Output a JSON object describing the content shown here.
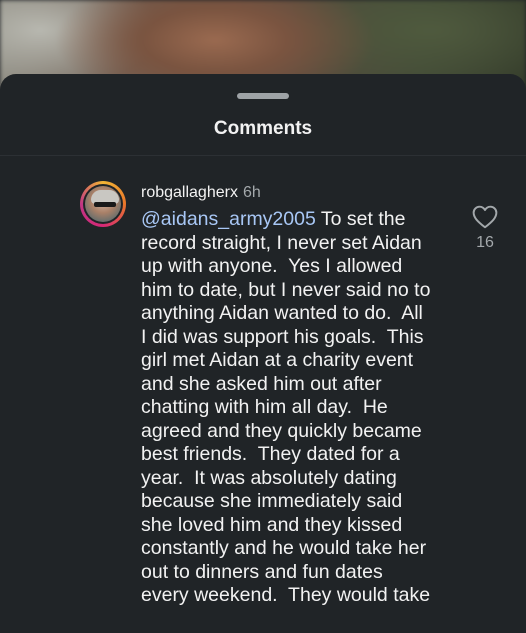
{
  "sheet": {
    "title": "Comments"
  },
  "comment": {
    "username": "robgallagherx",
    "time": "6h",
    "mention": "@aidans_army2005",
    "lines": [
      " To set the\nrecord straight, I never set Aidan\nup with anyone.  Yes I allowed\nhim to date, but I never said no to\nanything Aidan wanted to do.  All\nI did was support his goals.  This\ngirl met Aidan at a charity event\nand she asked him out after\nchatting with him all day.  He\nagreed and they quickly became\nbest friends.  They dated for a\nyear.  It was absolutely dating\nbecause she immediately said\nshe loved him and they kissed\nconstantly and he would take her\nout to dinners and fun dates\nevery weekend.  They would take"
    ],
    "like_count": "16"
  },
  "icons": {
    "like": "heart-icon",
    "avatar": "profile-avatar"
  },
  "colors": {
    "sheet_bg": "#202427",
    "mention": "#a8c7f5",
    "text": "#f2f2f2",
    "secondary": "#a3a8ab"
  }
}
